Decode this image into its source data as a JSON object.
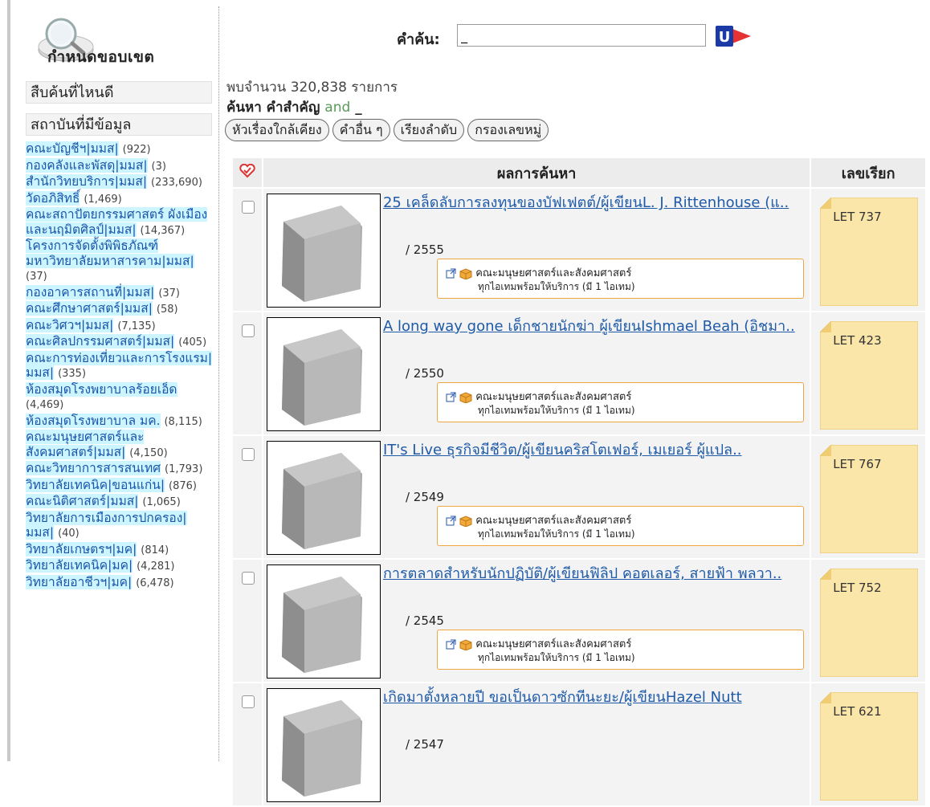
{
  "sidebar": {
    "scope_title": "กำหนดขอบเขต",
    "filter_search_where": "สืบค้นที่ไหนดี",
    "filter_institutions": "สถาบันที่มีข้อมูล",
    "institutions": [
      {
        "name": "คณะบัญชีฯ|มมส|",
        "count": "(922)"
      },
      {
        "name": "กองคลังและพัสดุ|มมส|",
        "count": "(3)"
      },
      {
        "name": "สำนักวิทยบริการ|มมส|",
        "count": "(233,690)"
      },
      {
        "name": "วัดอภิสิทธิ์",
        "count": "(1,469)"
      },
      {
        "name": "คณะสถาปัตยกรรมศาสตร์ ผังเมืองและนฤมิตศิลป์|มมส|",
        "count": "(14,367)"
      },
      {
        "name": "โครงการจัดตั้งพิพิธภัณฑ์ มหาวิทยาลัยมหาสารคาม|มมส|",
        "count": "(37)"
      },
      {
        "name": "กองอาคารสถานที่|มมส|",
        "count": "(37)"
      },
      {
        "name": "คณะศึกษาศาสตร์|มมส|",
        "count": "(58)"
      },
      {
        "name": "คณะวิศวฯ|มมส|",
        "count": "(7,135)"
      },
      {
        "name": "คณะศิลปกรรมศาสตร์|มมส|",
        "count": "(405)"
      },
      {
        "name": "คณะการท่องเที่ยวและการโรงแรม|มมส|",
        "count": "(335)"
      },
      {
        "name": "ห้องสมุดโรงพยาบาลร้อยเอ็ด",
        "count": "(4,469)"
      },
      {
        "name": "ห้องสมุดโรงพยาบาล มค.",
        "count": "(8,115)"
      },
      {
        "name": "คณะมนุษยศาสตร์และสังคมศาสตร์|มมส|",
        "count": "(4,150)"
      },
      {
        "name": "คณะวิทยาการสารสนเทศ",
        "count": "(1,793)"
      },
      {
        "name": "วิทยาลัยเทคนิค|ขอนแก่น|",
        "count": "(876)"
      },
      {
        "name": "คณะนิติศาสตร์|มมส|",
        "count": "(1,065)"
      },
      {
        "name": "วิทยาลัยการเมืองการปกครอง|มมส|",
        "count": "(40)"
      },
      {
        "name": "วิทยาลัยเกษตรฯ|มค|",
        "count": "(814)"
      },
      {
        "name": "วิทยาลัยเทคนิค|มค|",
        "count": "(4,281)"
      },
      {
        "name": "วิทยาลัยอาชีวฯ|มค|",
        "count": "(6,478)"
      }
    ]
  },
  "search": {
    "label": "คำค้น:",
    "value": "_"
  },
  "results_info": "พบจำนวน 320,838 รายการ",
  "query": {
    "prefix": "ค้นหา คำสำคัญ",
    "operator": "and",
    "term": "_"
  },
  "chips": [
    "หัวเรื่องใกล้เคียง",
    "คำอื่น ๆ",
    "เรียงลำดับ",
    "กรองเลขหมู่"
  ],
  "table": {
    "col_result": "ผลการค้นหา",
    "col_call": "เลขเรียก"
  },
  "results": [
    {
      "title": "25 เคล็ดลับการลงทุนของบัฟเฟตต์/ผู้เขียนL. J. Rittenhouse (แ..",
      "year": "/ 2555",
      "dept": "คณะมนุษยศาสตร์และสังคมศาสตร์",
      "avail": "ทุกไอเทมพร้อมให้บริการ (มี 1 ไอเทม)",
      "call": "LET 737"
    },
    {
      "title": "A long way gone เด็กชายนักฆ่า ผู้เขียนIshmael Beah (อิชมา..",
      "year": "/ 2550",
      "dept": "คณะมนุษยศาสตร์และสังคมศาสตร์",
      "avail": "ทุกไอเทมพร้อมให้บริการ (มี 1 ไอเทม)",
      "call": "LET 423"
    },
    {
      "title": "IT's Live ธุรกิจมีชีวิต/ผู้เขียนคริสโตเฟอร์, เมเยอร์ ผู้แปล..",
      "year": "/ 2549",
      "dept": "คณะมนุษยศาสตร์และสังคมศาสตร์",
      "avail": "ทุกไอเทมพร้อมให้บริการ (มี 1 ไอเทม)",
      "call": "LET 767"
    },
    {
      "title": "การตลาดสำหรับนักปฏิบัติ/ผู้เขียนฟิลิป คอตเลอร์, สายฟ้า พลวา..",
      "year": "/ 2545",
      "dept": "คณะมนุษยศาสตร์และสังคมศาสตร์",
      "avail": "ทุกไอเทมพร้อมให้บริการ (มี 1 ไอเทม)",
      "call": "LET 752"
    },
    {
      "title": "เกิดมาตั้งหลายปี ขอเป็นดาวซักทีนะยะ/ผู้เขียนHazel Nutt",
      "year": "/ 2547",
      "dept": "",
      "avail": "",
      "call": "LET 621"
    }
  ]
}
